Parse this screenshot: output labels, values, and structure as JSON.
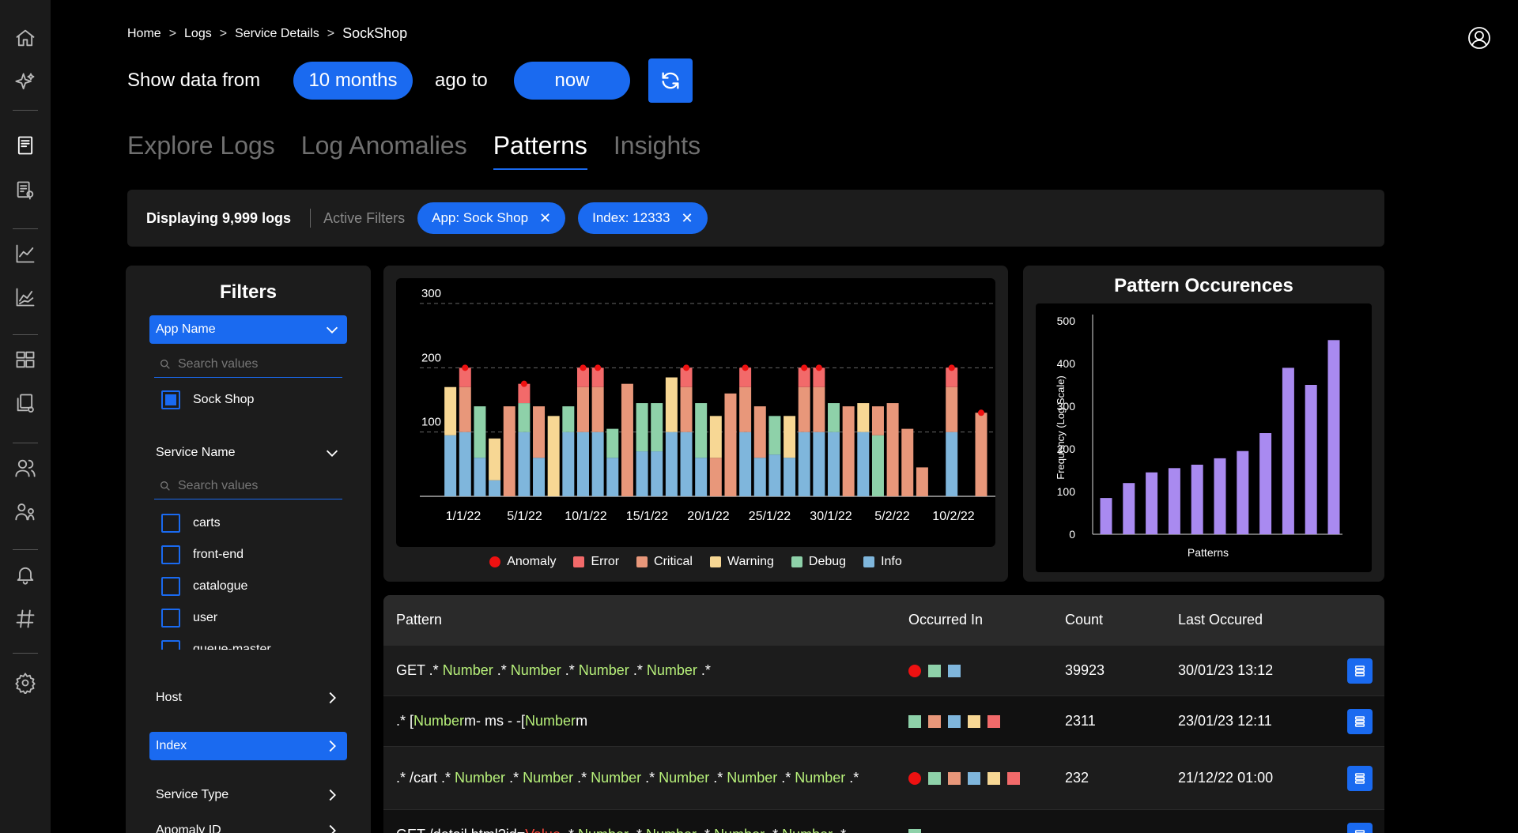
{
  "breadcrumb": [
    "Home",
    "Logs",
    "Service Details",
    "SockShop"
  ],
  "time_range": {
    "prefix": "Show data from",
    "from_value": "10 months",
    "middle": "ago to",
    "to_value": "now"
  },
  "tabs": [
    {
      "label": "Explore Logs",
      "active": false
    },
    {
      "label": "Log Anomalies",
      "active": false
    },
    {
      "label": "Patterns",
      "active": true
    },
    {
      "label": "Insights",
      "active": false
    }
  ],
  "filter_bar": {
    "displaying": "Displaying 9,999 logs",
    "active_filters_label": "Active Filters",
    "chips": [
      "App: Sock Shop",
      "Index: 12333"
    ]
  },
  "filters": {
    "title": "Filters",
    "app_name": {
      "label": "App Name",
      "search_placeholder": "Search values",
      "options": [
        {
          "label": "Sock Shop",
          "checked": true
        }
      ]
    },
    "service_name": {
      "label": "Service Name",
      "search_placeholder": "Search values",
      "options": [
        {
          "label": "carts",
          "checked": false
        },
        {
          "label": "front-end",
          "checked": false
        },
        {
          "label": "catalogue",
          "checked": false
        },
        {
          "label": "user",
          "checked": false
        },
        {
          "label": "queue-master",
          "checked": false
        }
      ]
    },
    "host_label": "Host",
    "index_label": "Index",
    "service_type_label": "Service Type",
    "anomaly_id_label": "Anomaly ID"
  },
  "colors": {
    "accent": "#1a6af0",
    "anomaly": "#ee1111",
    "error": "#f26a6a",
    "critical": "#e8977a",
    "warning": "#f7d794",
    "debug": "#8ed1a9",
    "info": "#7fb6dc",
    "occurrence_bar": "#a98af0",
    "pattern_number": "#b7f07a",
    "pattern_value": "#ff4a3d"
  },
  "legend": [
    {
      "label": "Anomaly",
      "key": "anomaly",
      "shape": "dot"
    },
    {
      "label": "Error",
      "key": "error",
      "shape": "square"
    },
    {
      "label": "Critical",
      "key": "critical",
      "shape": "square"
    },
    {
      "label": "Warning",
      "key": "warning",
      "shape": "square"
    },
    {
      "label": "Debug",
      "key": "debug",
      "shape": "square"
    },
    {
      "label": "Info",
      "key": "info",
      "shape": "square"
    }
  ],
  "chart_data": [
    {
      "type": "bar",
      "stacked": true,
      "ylim": [
        0,
        300
      ],
      "y_ticks": [
        100,
        200,
        300
      ],
      "grid": "dashed at y ticks",
      "x_tick_labels": [
        "1/1/22",
        "5/1/22",
        "10/1/22",
        "15/1/22",
        "20/1/22",
        "25/1/22",
        "30/1/22",
        "5/2/22",
        "10/2/22"
      ],
      "bar_stacks": [
        {
          "info": 0,
          "debug": 0,
          "critical": 0,
          "warning": 0,
          "error": 0,
          "anomaly": false
        },
        {
          "info": 95,
          "debug": 0,
          "critical": 0,
          "warning": 75,
          "error": 0,
          "anomaly": false
        },
        {
          "info": 100,
          "debug": 0,
          "critical": 70,
          "warning": 0,
          "error": 30,
          "anomaly": true
        },
        {
          "info": 60,
          "debug": 80,
          "critical": 0,
          "warning": 0,
          "error": 0,
          "anomaly": false
        },
        {
          "info": 25,
          "debug": 0,
          "critical": 0,
          "warning": 65,
          "error": 0,
          "anomaly": false
        },
        {
          "info": 0,
          "debug": 0,
          "critical": 140,
          "warning": 0,
          "error": 0,
          "anomaly": false
        },
        {
          "info": 100,
          "debug": 45,
          "critical": 0,
          "warning": 0,
          "error": 30,
          "anomaly": true
        },
        {
          "info": 60,
          "debug": 0,
          "critical": 80,
          "warning": 0,
          "error": 0,
          "anomaly": false
        },
        {
          "info": 0,
          "debug": 0,
          "critical": 0,
          "warning": 125,
          "error": 0,
          "anomaly": false
        },
        {
          "info": 100,
          "debug": 40,
          "critical": 0,
          "warning": 0,
          "error": 0,
          "anomaly": false
        },
        {
          "info": 100,
          "debug": 0,
          "critical": 70,
          "warning": 0,
          "error": 30,
          "anomaly": true
        },
        {
          "info": 100,
          "debug": 0,
          "critical": 70,
          "warning": 0,
          "error": 30,
          "anomaly": true
        },
        {
          "info": 60,
          "debug": 45,
          "critical": 0,
          "warning": 0,
          "error": 0,
          "anomaly": false
        },
        {
          "info": 0,
          "debug": 0,
          "critical": 175,
          "warning": 0,
          "error": 0,
          "anomaly": false
        },
        {
          "info": 70,
          "debug": 75,
          "critical": 0,
          "warning": 0,
          "error": 0,
          "anomaly": false
        },
        {
          "info": 70,
          "debug": 75,
          "critical": 0,
          "warning": 0,
          "error": 0,
          "anomaly": false
        },
        {
          "info": 100,
          "debug": 0,
          "critical": 0,
          "warning": 85,
          "error": 0,
          "anomaly": false
        },
        {
          "info": 100,
          "debug": 0,
          "critical": 70,
          "warning": 0,
          "error": 30,
          "anomaly": true
        },
        {
          "info": 60,
          "debug": 85,
          "critical": 0,
          "warning": 0,
          "error": 0,
          "anomaly": false
        },
        {
          "info": 0,
          "debug": 0,
          "critical": 60,
          "warning": 65,
          "error": 0,
          "anomaly": false
        },
        {
          "info": 0,
          "debug": 0,
          "critical": 160,
          "warning": 0,
          "error": 0,
          "anomaly": false
        },
        {
          "info": 100,
          "debug": 0,
          "critical": 70,
          "warning": 0,
          "error": 30,
          "anomaly": true
        },
        {
          "info": 60,
          "debug": 0,
          "critical": 80,
          "warning": 0,
          "error": 0,
          "anomaly": false
        },
        {
          "info": 65,
          "debug": 60,
          "critical": 0,
          "warning": 0,
          "error": 0,
          "anomaly": false
        },
        {
          "info": 60,
          "debug": 0,
          "critical": 0,
          "warning": 65,
          "error": 0,
          "anomaly": false
        },
        {
          "info": 100,
          "debug": 0,
          "critical": 70,
          "warning": 0,
          "error": 30,
          "anomaly": true
        },
        {
          "info": 100,
          "debug": 0,
          "critical": 70,
          "warning": 0,
          "error": 30,
          "anomaly": true
        },
        {
          "info": 100,
          "debug": 45,
          "critical": 0,
          "warning": 0,
          "error": 0,
          "anomaly": false
        },
        {
          "info": 0,
          "debug": 0,
          "critical": 140,
          "warning": 0,
          "error": 0,
          "anomaly": false
        },
        {
          "info": 100,
          "debug": 0,
          "critical": 0,
          "warning": 45,
          "error": 0,
          "anomaly": false
        },
        {
          "info": 0,
          "debug": 95,
          "critical": 45,
          "warning": 0,
          "error": 0,
          "anomaly": false
        },
        {
          "info": 0,
          "debug": 0,
          "critical": 145,
          "warning": 0,
          "error": 0,
          "anomaly": false
        },
        {
          "info": 0,
          "debug": 0,
          "critical": 105,
          "warning": 0,
          "error": 0,
          "anomaly": false
        },
        {
          "info": 0,
          "debug": 0,
          "critical": 45,
          "warning": 0,
          "error": 0,
          "anomaly": false
        },
        {
          "info": 0,
          "debug": 0,
          "critical": 0,
          "warning": 0,
          "error": 0,
          "anomaly": false
        },
        {
          "info": 100,
          "debug": 0,
          "critical": 70,
          "warning": 0,
          "error": 30,
          "anomaly": true
        },
        {
          "info": 0,
          "debug": 0,
          "critical": 0,
          "warning": 0,
          "error": 0,
          "anomaly": false
        },
        {
          "info": 0,
          "debug": 0,
          "critical": 130,
          "warning": 0,
          "error": 0,
          "anomaly": true
        }
      ]
    },
    {
      "type": "bar",
      "title": "Pattern Occurences",
      "xlabel": "Patterns",
      "ylabel": "Frequency (Log Scale)",
      "ylim": [
        0,
        500
      ],
      "y_ticks": [
        0,
        100,
        200,
        300,
        400,
        500
      ],
      "values": [
        85,
        120,
        145,
        155,
        163,
        178,
        195,
        237,
        390,
        350,
        455
      ]
    }
  ],
  "table": {
    "headers": [
      "Pattern",
      "Occurred In",
      "Count",
      "Last Occured"
    ],
    "rows": [
      {
        "pattern": [
          [
            "GET .* ",
            "t"
          ],
          [
            "Number",
            "n"
          ],
          [
            " .* ",
            "t"
          ],
          [
            "Number",
            "n"
          ],
          [
            " .* ",
            "t"
          ],
          [
            "Number",
            "n"
          ],
          [
            " .* ",
            "t"
          ],
          [
            "Number",
            "n"
          ],
          [
            " .*",
            "t"
          ]
        ],
        "occurred_in": [
          "anomaly",
          "debug",
          "info"
        ],
        "count": "39923",
        "last": "30/01/23 13:12"
      },
      {
        "pattern": [
          [
            ".* [",
            "t"
          ],
          [
            "Number",
            "n"
          ],
          [
            "m- ms - -[",
            "t"
          ],
          [
            "Number",
            "n"
          ],
          [
            "m",
            "t"
          ]
        ],
        "occurred_in": [
          "debug",
          "critical",
          "info",
          "warning",
          "error"
        ],
        "count": "2311",
        "last": "23/01/23 12:11"
      },
      {
        "pattern": [
          [
            ".* /cart .* ",
            "t"
          ],
          [
            "Number",
            "n"
          ],
          [
            " .* ",
            "t"
          ],
          [
            "Number",
            "n"
          ],
          [
            " .* ",
            "t"
          ],
          [
            "Number",
            "n"
          ],
          [
            " .* ",
            "t"
          ],
          [
            "Number",
            "n"
          ],
          [
            " .* ",
            "t"
          ],
          [
            "Number",
            "n"
          ],
          [
            " .* ",
            "t"
          ],
          [
            "Number",
            "n"
          ],
          [
            " .*",
            "t"
          ]
        ],
        "occurred_in": [
          "anomaly",
          "debug",
          "critical",
          "info",
          "warning",
          "error"
        ],
        "count": "232",
        "last": "21/12/22 01:00"
      },
      {
        "pattern": [
          [
            "GET /detail.html?id=",
            "t"
          ],
          [
            "Value",
            "v"
          ],
          [
            " .* ",
            "t"
          ],
          [
            "Number",
            "n"
          ],
          [
            " .* ",
            "t"
          ],
          [
            "Number",
            "n"
          ],
          [
            " .* ",
            "t"
          ],
          [
            "Number",
            "n"
          ],
          [
            " .* ",
            "t"
          ],
          [
            "Number",
            "n"
          ],
          [
            " .*",
            "t"
          ]
        ],
        "occurred_in": [
          "debug"
        ],
        "count": "",
        "last": ""
      }
    ]
  },
  "icons": [
    "home-icon",
    "sparkles-icon",
    "logs-icon",
    "log-search-icon",
    "line-chart-icon",
    "multi-chart-icon",
    "dashboard-icon",
    "copy-settings-icon",
    "users-icon",
    "user-group-icon",
    "bell-icon",
    "hashtag-icon",
    "settings-icon",
    "user-avatar-icon",
    "refresh-icon"
  ]
}
